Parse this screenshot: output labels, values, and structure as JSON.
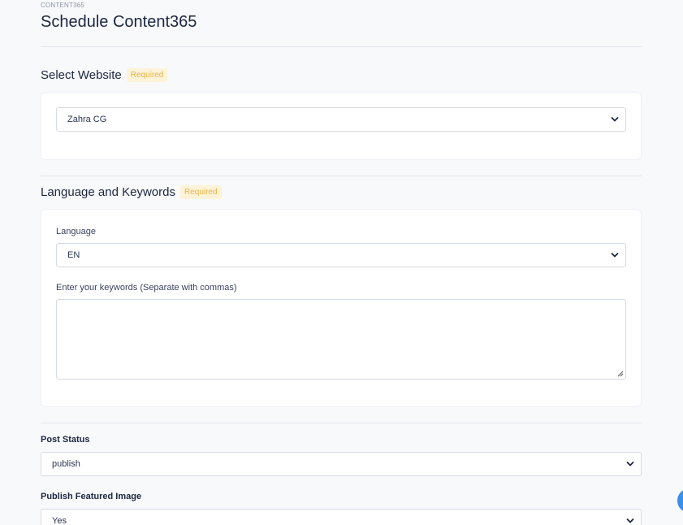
{
  "header": {
    "eyebrow": "CONTENT365",
    "title": "Schedule Content365"
  },
  "website_section": {
    "title": "Select Website",
    "badge": "Required",
    "selected_website": "Zahra CG"
  },
  "language_section": {
    "title": "Language and Keywords",
    "badge": "Required",
    "language_label": "Language",
    "selected_language": "EN",
    "keywords_label": "Enter your keywords (Separate with commas)",
    "keywords_value": ""
  },
  "post_status": {
    "label": "Post Status",
    "selected": "publish"
  },
  "featured_image": {
    "label": "Publish Featured Image",
    "selected": "Yes"
  },
  "icons": {
    "select_arrow": "chevron-down-icon",
    "resize": "resize-grip-icon",
    "help": "help-bubble-icon"
  },
  "colors": {
    "badge_bg": "#fdf3d8",
    "badge_text": "#e8b44a",
    "fab": "#3b8eea"
  }
}
